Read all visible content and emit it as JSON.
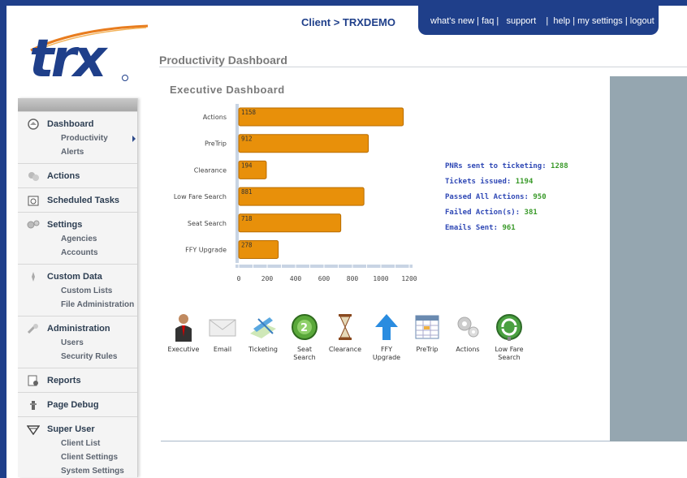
{
  "header": {
    "client_label": "Client > TRXDEMO",
    "nav": [
      "what's new",
      "faq",
      "support",
      "help",
      "my settings",
      "logout"
    ]
  },
  "logo": {
    "text": "trx"
  },
  "page_title": "Productivity Dashboard",
  "sidebar": {
    "sections": [
      {
        "label": "Dashboard",
        "icon": "dashboard-icon",
        "items": [
          "Productivity",
          "Alerts"
        ]
      },
      {
        "label": "Actions",
        "icon": "actions-icon",
        "items": []
      },
      {
        "label": "Scheduled Tasks",
        "icon": "scheduled-tasks-icon",
        "items": []
      },
      {
        "label": "Settings",
        "icon": "settings-icon",
        "items": [
          "Agencies",
          "Accounts"
        ]
      },
      {
        "label": "Custom Data",
        "icon": "custom-data-icon",
        "items": [
          "Custom Lists",
          "File Administration"
        ]
      },
      {
        "label": "Administration",
        "icon": "administration-icon",
        "items": [
          "Users",
          "Security Rules"
        ]
      },
      {
        "label": "Reports",
        "icon": "reports-icon",
        "items": []
      },
      {
        "label": "Page Debug",
        "icon": "page-debug-icon",
        "items": []
      },
      {
        "label": "Super User",
        "icon": "super-user-icon",
        "items": [
          "Client List",
          "Client Settings",
          "System Settings"
        ]
      }
    ]
  },
  "dashboard_title": "Executive Dashboard",
  "chart_data": {
    "type": "bar",
    "orientation": "horizontal",
    "categories": [
      "Actions",
      "PreTrip",
      "Clearance",
      "Low Fare Search",
      "Seat Search",
      "FFY Upgrade"
    ],
    "values": [
      1158,
      912,
      194,
      881,
      718,
      278
    ],
    "xlim": [
      0,
      1200
    ],
    "xticks": [
      0,
      200,
      400,
      600,
      800,
      1000,
      1200
    ],
    "bar_color": "#e8900a"
  },
  "stats": [
    {
      "label": "PNRs sent to ticketing:",
      "value": "1288"
    },
    {
      "label": "Tickets issued:",
      "value": "1194"
    },
    {
      "label": "Passed All Actions:",
      "value": "950"
    },
    {
      "label": "Failed Action(s):",
      "value": "381"
    },
    {
      "label": "Emails Sent:",
      "value": "961"
    }
  ],
  "quick_links": [
    {
      "label": "Executive",
      "icon": "executive-icon"
    },
    {
      "label": "Email",
      "icon": "email-icon"
    },
    {
      "label": "Ticketing",
      "icon": "ticketing-icon"
    },
    {
      "label": "Seat\nSearch",
      "icon": "seat-search-icon"
    },
    {
      "label": "Clearance",
      "icon": "clearance-icon"
    },
    {
      "label": "FFY\nUpgrade",
      "icon": "ffy-upgrade-icon"
    },
    {
      "label": "PreTrip",
      "icon": "pretrip-icon"
    },
    {
      "label": "Actions",
      "icon": "actions-icon"
    },
    {
      "label": "Low Fare\nSearch",
      "icon": "low-fare-search-icon"
    }
  ]
}
